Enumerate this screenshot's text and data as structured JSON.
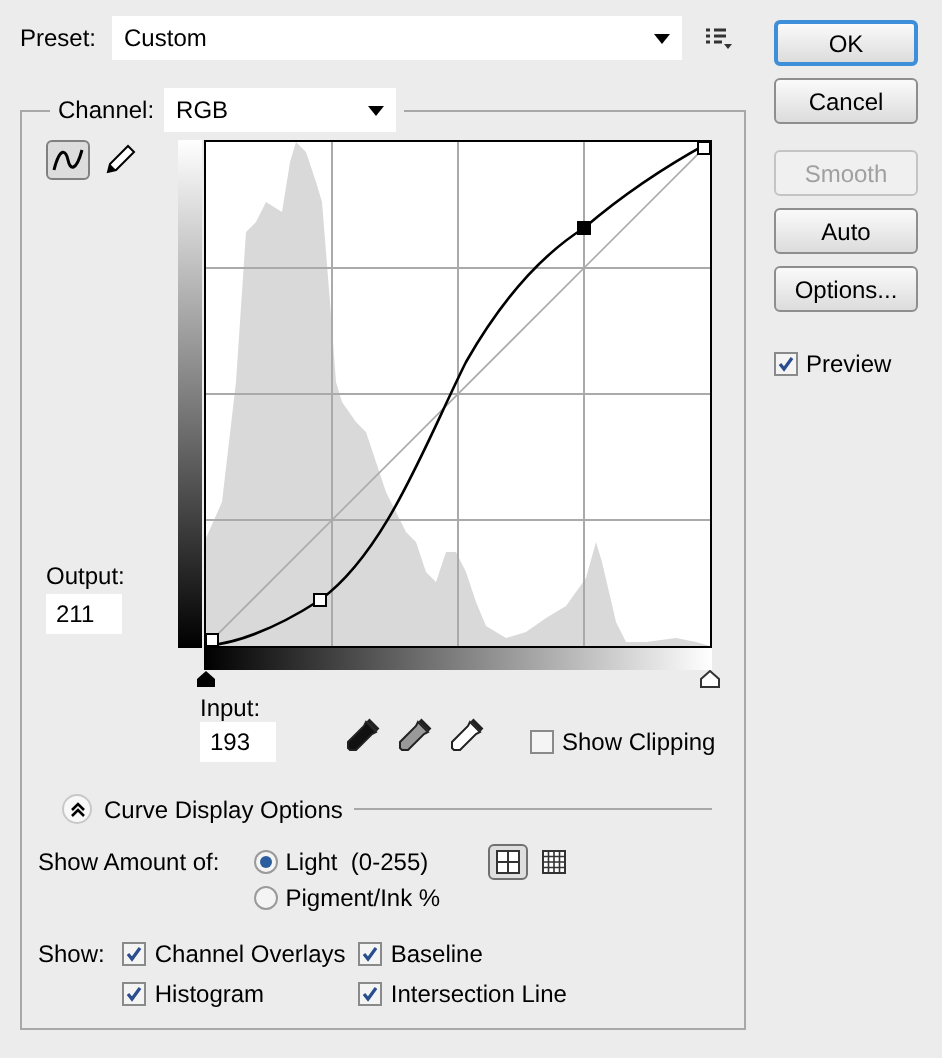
{
  "preset": {
    "label": "Preset:",
    "value": "Custom"
  },
  "buttons": [
    {
      "label": "OK",
      "disabled": false,
      "default": true
    },
    {
      "label": "Cancel",
      "disabled": false,
      "default": false
    },
    {
      "label": "Smooth",
      "disabled": true,
      "default": false
    },
    {
      "label": "Auto",
      "disabled": false,
      "default": false
    },
    {
      "label": "Options...",
      "disabled": false,
      "default": false
    }
  ],
  "preview": {
    "label": "Preview",
    "checked": true
  },
  "channel": {
    "label": "Channel:",
    "value": "RGB"
  },
  "tools": [
    {
      "kind": "curve",
      "selected": true
    },
    {
      "kind": "pencil",
      "selected": false
    }
  ],
  "output": {
    "label": "Output:",
    "value": "211"
  },
  "input": {
    "label": "Input:",
    "value": "193"
  },
  "show_clipping": {
    "label": "Show Clipping",
    "checked": false
  },
  "display_options": {
    "title": "Curve Display Options",
    "expanded": true
  },
  "show_amount": {
    "label": "Show Amount of:",
    "options": [
      {
        "label": "Light  (0-255)",
        "selected": true
      },
      {
        "label": "Pigment/Ink %",
        "selected": false
      }
    ]
  },
  "grid_sizes": [
    {
      "kind": "coarse",
      "selected": true
    },
    {
      "kind": "fine",
      "selected": false
    }
  ],
  "show": {
    "label": "Show:",
    "options": [
      {
        "label": "Channel Overlays",
        "checked": true
      },
      {
        "label": "Baseline",
        "checked": true
      },
      {
        "label": "Histogram",
        "checked": true
      },
      {
        "label": "Intersection Line",
        "checked": true
      }
    ]
  }
}
